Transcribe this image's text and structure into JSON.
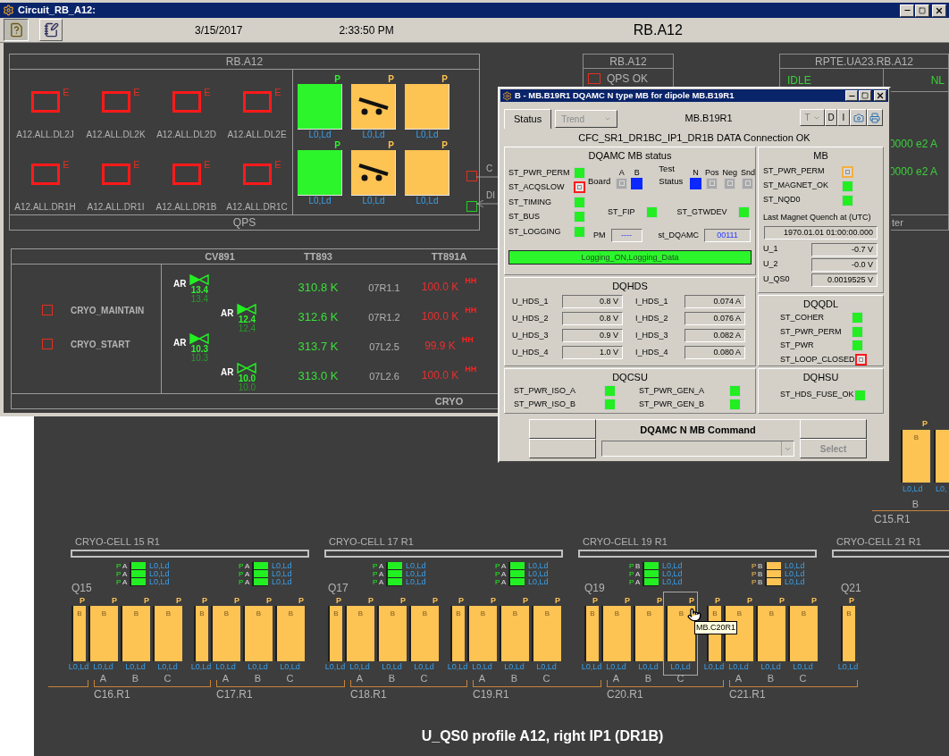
{
  "window": {
    "title": "Circuit_RB_A12:"
  },
  "toolbar": {
    "date": "3/15/2017",
    "time": "2:33:50 PM",
    "heading": "RB.A12"
  },
  "qps_panel": {
    "title": "RB.A12",
    "footer": "QPS",
    "switches": [
      {
        "label": "A12.ALL.DL2J",
        "flag": "E"
      },
      {
        "label": "A12.ALL.DL2K",
        "flag": "E"
      },
      {
        "label": "A12.ALL.DL2D",
        "flag": "E"
      },
      {
        "label": "A12.ALL.DL2E",
        "flag": "E"
      },
      {
        "label": "A12.ALL.DR1H",
        "flag": "E"
      },
      {
        "label": "A12.ALL.DR1I",
        "flag": "E"
      },
      {
        "label": "A12.ALL.DR1B",
        "flag": "E"
      },
      {
        "label": "A12.ALL.DR1C",
        "flag": "E"
      }
    ],
    "magnets": [
      {
        "flag": "P",
        "color": "#2cf52c",
        "kind": "plain",
        "status": "L0,Ld"
      },
      {
        "flag": "P",
        "color": "#fdc353",
        "kind": "switch",
        "status": "L0,Ld"
      },
      {
        "flag": "P",
        "color": "#fdc353",
        "kind": "plain",
        "status": "L0,Ld"
      },
      {
        "flag": "P",
        "color": "#2cf52c",
        "kind": "plain",
        "status": "L0,Ld"
      },
      {
        "flag": "P",
        "color": "#fdc353",
        "kind": "switch",
        "status": "L0,Ld"
      },
      {
        "flag": "P",
        "color": "#fdc353",
        "kind": "plain",
        "status": "L0,Ld"
      }
    ],
    "links": [
      {
        "color": "#e03020",
        "kind": "line",
        "label": "C"
      },
      {
        "color": "#22d022",
        "kind": "arrow",
        "label": "DI"
      }
    ]
  },
  "cryo_panel": {
    "columns": [
      "CV891",
      "TT893",
      "TT891A"
    ],
    "footer": "CRYO",
    "modes": [
      {
        "label": "CRYO_MAINTAIN",
        "checked": false
      },
      {
        "label": "CRYO_START",
        "checked": false
      }
    ],
    "valves": [
      {
        "mode": "AR",
        "active": true,
        "value": "13.4",
        "setpoint": "13.4",
        "temperature": "310.8 K",
        "sensor": "07R1.1",
        "reading": "100.0 K",
        "alarm": "HH"
      },
      {
        "mode": "AR",
        "active": true,
        "value": "12.4",
        "setpoint": "12.4",
        "temperature": "312.6 K",
        "sensor": "07R1.2",
        "reading": "100.0 K",
        "alarm": "HH"
      },
      {
        "mode": "AR",
        "active": true,
        "value": "10.3",
        "setpoint": "10.3",
        "temperature": "313.7 K",
        "sensor": "07L2.5",
        "reading": "99.9 K",
        "alarm": "HH"
      },
      {
        "mode": "AR",
        "active": false,
        "value": "10.0",
        "setpoint": "10.0",
        "temperature": "313.0 K",
        "sensor": "07L2.6",
        "reading": "100.0 K",
        "alarm": "HH"
      }
    ]
  },
  "qps_summary": {
    "title": "RB.A12",
    "items": [
      {
        "label": "QPS OK",
        "checked": false
      }
    ]
  },
  "rpte_panel": {
    "title": "RPTE.UA23.RB.A12",
    "state": "IDLE",
    "mode": "NL",
    "currents": [
      "0000 e2 A",
      "0000 e2 A"
    ],
    "footer": "ter"
  },
  "dialog": {
    "title": "B - MB.B19R1 DQAMC N type MB for dipole MB.B19R1",
    "tabs": [
      {
        "label": "Status",
        "selected": true
      },
      {
        "label": "Trend",
        "selected": false
      }
    ],
    "device": "MB.B19R1",
    "tools": [
      "T",
      "D",
      "I"
    ],
    "connection": "CFC_SR1_DR1BC_IP1_DR1B DATA Connection OK",
    "status": {
      "title": "DQAMC MB status",
      "signals": [
        {
          "label": "ST_PWR_PERM",
          "kind": "ok"
        },
        {
          "label": "ST_ACQSLOW",
          "kind": "fault"
        },
        {
          "label": "ST_TIMING",
          "kind": "ok"
        },
        {
          "label": "ST_BUS",
          "kind": "ok"
        },
        {
          "label": "ST_LOGGING",
          "kind": "ok"
        }
      ],
      "board": {
        "label": "Board",
        "channels": [
          {
            "label": "A",
            "kind": "inactive"
          },
          {
            "label": "B",
            "kind": "on"
          }
        ]
      },
      "test": {
        "label": "Test Status",
        "channels": [
          {
            "label": "N",
            "kind": "on"
          },
          {
            "label": "Pos",
            "kind": "inactive"
          },
          {
            "label": "Neg",
            "kind": "inactive"
          },
          {
            "label": "Snd",
            "kind": "inactive"
          }
        ]
      },
      "links": [
        {
          "label": "ST_FIP",
          "kind": "ok"
        },
        {
          "label": "ST_GTWDEV",
          "kind": "ok"
        }
      ],
      "fields": [
        {
          "label": "PM",
          "value": "----"
        },
        {
          "label": "st_DQAMC",
          "value": "00111"
        }
      ],
      "logging": "Logging_ON,Logging_Data"
    },
    "mb": {
      "title": "MB",
      "signals": [
        {
          "label": "ST_PWR_PERM",
          "kind": "warning"
        },
        {
          "label": "ST_MAGNET_OK",
          "kind": "ok"
        },
        {
          "label": "ST_NQD0",
          "kind": "ok"
        }
      ],
      "quench_label": "Last Magnet Quench at (UTC)",
      "quench_time": "1970.01.01 01:00:00.000",
      "readings": [
        {
          "label": "U_1",
          "value": "-0.7 V"
        },
        {
          "label": "U_2",
          "value": "-0.0 V"
        },
        {
          "label": "U_QS0",
          "value": "0.0019525 V"
        }
      ]
    },
    "dqhds": {
      "title": "DQHDS",
      "readings": [
        {
          "label": "U_HDS_1",
          "value": "0.8 V"
        },
        {
          "label": "I_HDS_1",
          "value": "0.074 A"
        },
        {
          "label": "U_HDS_2",
          "value": "0.8 V"
        },
        {
          "label": "I_HDS_2",
          "value": "0.076 A"
        },
        {
          "label": "U_HDS_3",
          "value": "0.9 V"
        },
        {
          "label": "I_HDS_3",
          "value": "0.082 A"
        },
        {
          "label": "U_HDS_4",
          "value": "1.0 V"
        },
        {
          "label": "I_HDS_4",
          "value": "0.080 A"
        }
      ]
    },
    "dqqdl": {
      "title": "DQQDL",
      "signals": [
        {
          "label": "ST_COHER",
          "kind": "ok"
        },
        {
          "label": "ST_PWR_PERM",
          "kind": "ok"
        },
        {
          "label": "ST_PWR",
          "kind": "ok"
        },
        {
          "label": "ST_LOOP_CLOSED",
          "kind": "fault"
        }
      ]
    },
    "dqcsu": {
      "title": "DQCSU",
      "signals": [
        {
          "label": "ST_PWR_ISO_A",
          "kind": "ok"
        },
        {
          "label": "ST_PWR_GEN_A",
          "kind": "ok"
        },
        {
          "label": "ST_PWR_ISO_B",
          "kind": "ok"
        },
        {
          "label": "ST_PWR_GEN_B",
          "kind": "ok"
        }
      ]
    },
    "dqhsu": {
      "title": "DQHSU",
      "signals": [
        {
          "label": "ST_HDS_FUSE_OK",
          "kind": "ok"
        }
      ]
    },
    "command": {
      "title": "DQAMC N MB Command",
      "action": "Select",
      "action_disabled": true
    }
  },
  "upper_row": {
    "magnets": [
      {
        "flag": "P",
        "label": "B",
        "status": "L0,Ld"
      },
      {
        "status": "L0,"
      }
    ],
    "letters": [
      "B"
    ],
    "label": "C15.R1"
  },
  "cryo_cells": [
    "CRYO-CELL 15 R1",
    "CRYO-CELL 17 R1",
    "CRYO-CELL 19 R1",
    "CRYO-CELL 21 R1"
  ],
  "magnet_groups": [
    {
      "quad_label": "Q15",
      "indicators": [
        {
          "flag": "P",
          "letter": "A",
          "color": "#22f022",
          "status": "L0,Ld"
        },
        {
          "flag": "P",
          "letter": "A",
          "color": "#22f022",
          "status": "L0,Ld"
        },
        {
          "flag": "P",
          "letter": "A",
          "color": "#22f022",
          "status": "L0,Ld"
        }
      ],
      "magnets": [
        {
          "kind": "quad",
          "flag": "P",
          "label": "B",
          "status": "L0,Ld",
          "selected": false
        },
        {
          "kind": "dipole",
          "flag": "P",
          "label": "B",
          "status": "L0,Ld",
          "selected": false
        },
        {
          "kind": "dipole",
          "flag": "P",
          "label": "B",
          "status": "L0,Ld",
          "selected": false
        },
        {
          "kind": "dipole",
          "flag": "P",
          "label": "B",
          "status": "L0,Ld",
          "selected": false
        }
      ],
      "cell": {
        "letters": [
          "A",
          "B",
          "C"
        ],
        "label": "C16.R1"
      }
    },
    {
      "indicators": [
        {
          "flag": "P",
          "letter": "A",
          "color": "#22f022",
          "status": "L0,Ld"
        },
        {
          "flag": "P",
          "letter": "A",
          "color": "#22f022",
          "status": "L0,Ld"
        },
        {
          "flag": "P",
          "letter": "A",
          "color": "#22f022",
          "status": "L0,Ld"
        }
      ],
      "magnets": [
        {
          "kind": "quad",
          "flag": "P",
          "label": "B",
          "status": "L0,Ld",
          "selected": false
        },
        {
          "kind": "dipole",
          "flag": "P",
          "label": "B",
          "status": "L0,Ld",
          "selected": false
        },
        {
          "kind": "dipole",
          "flag": "P",
          "label": "B",
          "status": "L0,Ld",
          "selected": false
        },
        {
          "kind": "dipole",
          "flag": "P",
          "label": "B",
          "status": "L0,Ld",
          "selected": false
        }
      ],
      "cell": {
        "letters": [
          "A",
          "B",
          "C"
        ],
        "label": "C17.R1"
      }
    },
    {
      "quad_label": "Q17",
      "indicators": [
        {
          "flag": "P",
          "letter": "A",
          "color": "#22f022",
          "status": "L0,Ld"
        },
        {
          "flag": "P",
          "letter": "A",
          "color": "#22f022",
          "status": "L0,Ld"
        },
        {
          "flag": "P",
          "letter": "A",
          "color": "#22f022",
          "status": "L0,Ld"
        }
      ],
      "magnets": [
        {
          "kind": "quad",
          "flag": "P",
          "label": "B",
          "status": "L0,Ld",
          "selected": false
        },
        {
          "kind": "dipole",
          "flag": "P",
          "label": "B",
          "status": "L0,Ld",
          "selected": false
        },
        {
          "kind": "dipole",
          "flag": "P",
          "label": "B",
          "status": "L0,Ld",
          "selected": false
        },
        {
          "kind": "dipole",
          "flag": "P",
          "label": "B",
          "status": "L0,Ld",
          "selected": false
        }
      ],
      "cell": {
        "letters": [
          "A",
          "B",
          "C"
        ],
        "label": "C18.R1"
      }
    },
    {
      "indicators": [
        {
          "flag": "P",
          "letter": "A",
          "color": "#22f022",
          "status": "L0,Ld"
        },
        {
          "flag": "P",
          "letter": "A",
          "color": "#22f022",
          "status": "L0,Ld"
        },
        {
          "flag": "P",
          "letter": "A",
          "color": "#22f022",
          "status": "L0,Ld"
        }
      ],
      "magnets": [
        {
          "kind": "quad",
          "flag": "P",
          "label": "B",
          "status": "L0,Ld",
          "selected": false
        },
        {
          "kind": "dipole",
          "flag": "P",
          "label": "B",
          "status": "L0,Ld",
          "selected": false
        },
        {
          "kind": "dipole",
          "flag": "P",
          "label": "B",
          "status": "L0,Ld",
          "selected": false
        },
        {
          "kind": "dipole",
          "flag": "P",
          "label": "B",
          "status": "L0,Ld",
          "selected": false
        }
      ],
      "cell": {
        "letters": [
          "A",
          "B",
          "C"
        ],
        "label": "C19.R1"
      }
    },
    {
      "quad_label": "Q19",
      "indicators": [
        {
          "flag": "P",
          "letter": "B",
          "color": "#22f022",
          "status": "L0,Ld"
        },
        {
          "flag": "P",
          "letter": "A",
          "color": "#22f022",
          "status": "L0,Ld"
        },
        {
          "flag": "P",
          "letter": "A",
          "color": "#22f022",
          "status": "L0,Ld"
        }
      ],
      "magnets": [
        {
          "kind": "quad",
          "flag": "P",
          "label": "B",
          "status": "L0,Ld",
          "selected": false
        },
        {
          "kind": "dipole",
          "flag": "P",
          "label": "B",
          "status": "L0,Ld",
          "selected": false
        },
        {
          "kind": "dipole",
          "flag": "P",
          "label": "B",
          "status": "L0,Ld",
          "selected": false
        },
        {
          "kind": "dipole",
          "flag": "P",
          "label": "B",
          "status": "L0,Ld",
          "selected": true,
          "tooltip": "MB.C20R1"
        }
      ],
      "cell": {
        "letters": [
          "A",
          "B",
          "C"
        ],
        "label": "C20.R1"
      }
    },
    {
      "indicators": [
        {
          "flag": "P",
          "letter": "B",
          "color": "#fdc353",
          "status": "L0,Ld"
        },
        {
          "flag": "P",
          "letter": "B",
          "color": "#fdc353",
          "status": "L0,Ld"
        },
        {
          "flag": "P",
          "letter": "B",
          "color": "#fdc353",
          "status": "L0,Ld"
        }
      ],
      "magnets": [
        {
          "kind": "quad",
          "flag": "P",
          "label": "B",
          "status": "L0,Ld",
          "selected": false
        },
        {
          "kind": "dipole",
          "flag": "P",
          "label": "B",
          "status": "L0,Ld",
          "selected": false
        },
        {
          "kind": "dipole",
          "flag": "P",
          "label": "B",
          "status": "L0,Ld",
          "selected": false
        },
        {
          "kind": "dipole",
          "flag": "P",
          "label": "B",
          "status": "L0,Ld",
          "selected": false
        }
      ],
      "cell": {
        "letters": [
          "A",
          "B",
          "C"
        ],
        "label": "C21.R1"
      }
    },
    {
      "quad_label": "Q21",
      "magnets": [
        {
          "kind": "quad",
          "flag": "P",
          "label": "B",
          "status": "L0,Ld",
          "selected": false
        }
      ]
    }
  ],
  "profile_title": "U_QS0 profile A12, right IP1 (DR1B)"
}
